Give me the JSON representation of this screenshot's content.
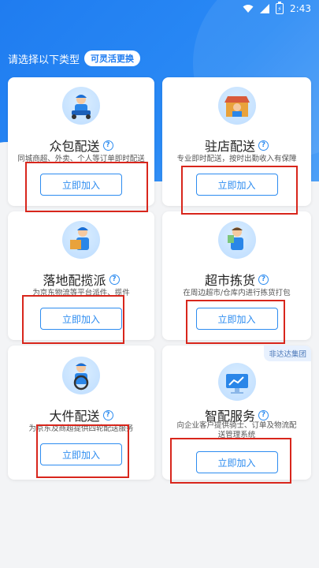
{
  "status": {
    "time": "2:43",
    "battery_glyph": "⚡"
  },
  "prompt": {
    "text": "请选择以下类型",
    "pill": "可灵活更换"
  },
  "cards": [
    {
      "title": "众包配送",
      "desc": "同城商超、外卖、个人等订单即时配送",
      "button": "立即加入"
    },
    {
      "title": "驻店配送",
      "desc": "专业即时配送，按时出勤收入有保障",
      "button": "立即加入"
    },
    {
      "title": "落地配揽派",
      "desc": "为京东物流等平台派件、揽件",
      "button": "立即加入"
    },
    {
      "title": "超市拣货",
      "desc": "在周边超市/仓库内进行拣货打包",
      "button": "立即加入"
    },
    {
      "title": "大件配送",
      "desc": "为京东及商超提供四轮配送服务",
      "button": "立即加入"
    },
    {
      "title": "智配服务",
      "desc": "向企业客户提供骑士、订单及物流配送管理系统",
      "button": "立即加入",
      "tag": "非达达集团"
    }
  ]
}
